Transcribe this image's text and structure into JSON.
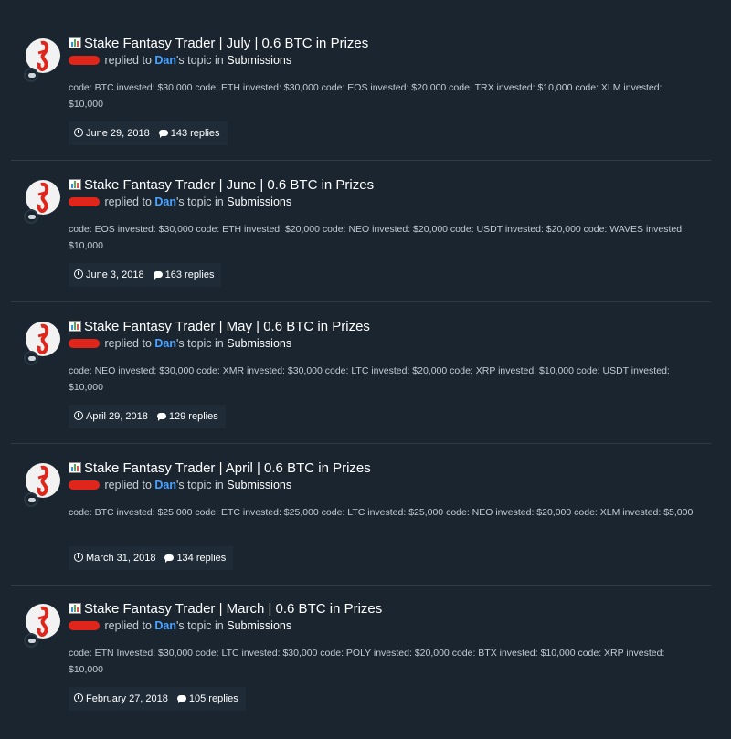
{
  "entries": [
    {
      "title": "Stake Fantasy Trader | July | 0.6 BTC in Prizes",
      "action_text": "replied to",
      "topic_owner": "Dan",
      "possessive": "'s topic in",
      "forum": "Submissions",
      "snippet": "code: BTC invested: $30,000 code: ETH invested: $30,000 code: EOS invested: $20,000 code: TRX invested: $10,000 code: XLM invested: $10,000",
      "date": "June 29, 2018",
      "replies": "143 replies"
    },
    {
      "title": "Stake Fantasy Trader | June | 0.6 BTC in Prizes",
      "action_text": "replied to",
      "topic_owner": "Dan",
      "possessive": "'s topic in",
      "forum": "Submissions",
      "snippet": "code: EOS invested: $30,000 code: ETH invested: $20,000 code: NEO invested: $20,000 code: USDT invested: $20,000 code: WAVES invested: $10,000",
      "date": "June 3, 2018",
      "replies": "163 replies"
    },
    {
      "title": "Stake Fantasy Trader | May | 0.6 BTC in Prizes",
      "action_text": "replied to",
      "topic_owner": "Dan",
      "possessive": "'s topic in",
      "forum": "Submissions",
      "snippet": "code: NEO invested: $30,000 code: XMR invested: $30,000 code: LTC invested: $20,000 code: XRP invested: $10,000 code: USDT invested: $10,000",
      "date": "April 29, 2018",
      "replies": "129 replies"
    },
    {
      "title": "Stake Fantasy Trader | April | 0.6 BTC in Prizes",
      "action_text": "replied to",
      "topic_owner": "Dan",
      "possessive": "'s topic in",
      "forum": "Submissions",
      "snippet": "code: BTC invested: $25,000 code: ETC invested: $25,000 code: LTC invested: $25,000 code: NEO invested: $20,000 code: XLM invested: $5,000",
      "date": "March 31, 2018",
      "replies": "134 replies"
    },
    {
      "title": "Stake Fantasy Trader | March | 0.6 BTC in Prizes",
      "action_text": "replied to",
      "topic_owner": "Dan",
      "possessive": "'s topic in",
      "forum": "Submissions",
      "snippet": "code: ETN Invested: $30,000 code: LTC invested: $30,000 code: POLY invested: $20,000 code: BTX invested: $10,000 code: XRP invested: $10,000",
      "date": "February 27, 2018",
      "replies": "105 replies"
    }
  ],
  "icons": {
    "title": "bar-chart-icon",
    "date": "clock-icon",
    "replies": "comment-icon",
    "badge": "comment-badge-icon"
  },
  "colors": {
    "background": "#1a2530",
    "link": "#4aa3ff",
    "redaction": "#e0261a"
  }
}
